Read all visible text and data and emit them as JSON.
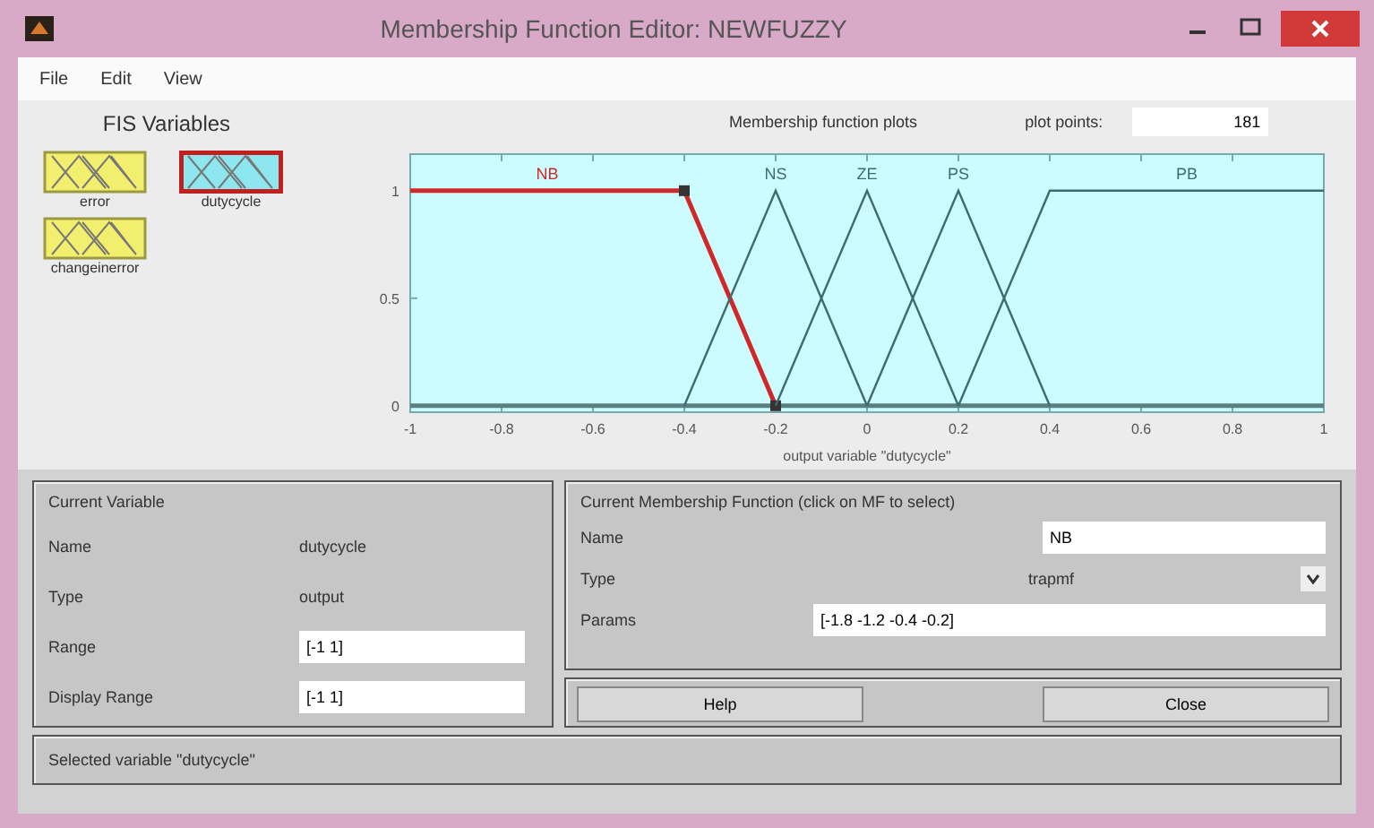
{
  "window": {
    "title": "Membership Function Editor: NEWFUZZY"
  },
  "menu": [
    "File",
    "Edit",
    "View"
  ],
  "fis_variables": {
    "title": "FIS Variables",
    "items": [
      {
        "name": "error",
        "kind": "input",
        "selected": false
      },
      {
        "name": "dutycycle",
        "kind": "output",
        "selected": true
      },
      {
        "name": "changeinerror",
        "kind": "input",
        "selected": false
      }
    ]
  },
  "plot": {
    "plot_points_label": "plot points:",
    "plot_points": "181",
    "chart_data": {
      "type": "line",
      "title": "Membership function plots",
      "xlabel": "output variable \"dutycycle\"",
      "x": [
        -1,
        -0.4,
        -0.2,
        0,
        0.2,
        0.4,
        1
      ],
      "series": [
        {
          "name": "NB",
          "color": "#d02828",
          "values": [
            1,
            1,
            0,
            null,
            null,
            null,
            null
          ]
        },
        {
          "name": "NS",
          "color": "#3a6e6e",
          "values": [
            null,
            0,
            1,
            0,
            null,
            null,
            null
          ]
        },
        {
          "name": "ZE",
          "color": "#3a6e6e",
          "values": [
            null,
            null,
            0,
            1,
            0,
            null,
            null
          ]
        },
        {
          "name": "PS",
          "color": "#3a6e6e",
          "values": [
            null,
            null,
            null,
            0,
            1,
            0,
            null
          ]
        },
        {
          "name": "PB",
          "color": "#3a6e6e",
          "values": [
            null,
            null,
            null,
            null,
            0,
            1,
            1
          ]
        }
      ],
      "xlim": [
        -1,
        1
      ],
      "ylim": [
        -0.03,
        1.17
      ],
      "xticks": [
        -1,
        -0.8,
        -0.6,
        -0.4,
        -0.2,
        0,
        0.2,
        0.4,
        0.6,
        0.8,
        1
      ],
      "yticks": [
        0,
        0.5,
        1
      ]
    },
    "curves": [
      {
        "selected": true
      },
      {
        "selected": false
      },
      {
        "selected": false
      },
      {
        "selected": false
      },
      {
        "selected": false
      }
    ]
  },
  "current_variable": {
    "title": "Current Variable",
    "name_label": "Name",
    "name": "dutycycle",
    "type_label": "Type",
    "type": "output",
    "range_label": "Range",
    "range": "[-1 1]",
    "display_range_label": "Display Range",
    "display_range": "[-1 1]"
  },
  "current_mf": {
    "title": "Current Membership Function (click on MF to select)",
    "name_label": "Name",
    "name": "NB",
    "type_label": "Type",
    "type": "trapmf",
    "params_label": "Params",
    "params": "[-1.8 -1.2 -0.4 -0.2]"
  },
  "buttons": [
    "Help",
    "Close"
  ],
  "status": "Selected variable \"dutycycle\""
}
